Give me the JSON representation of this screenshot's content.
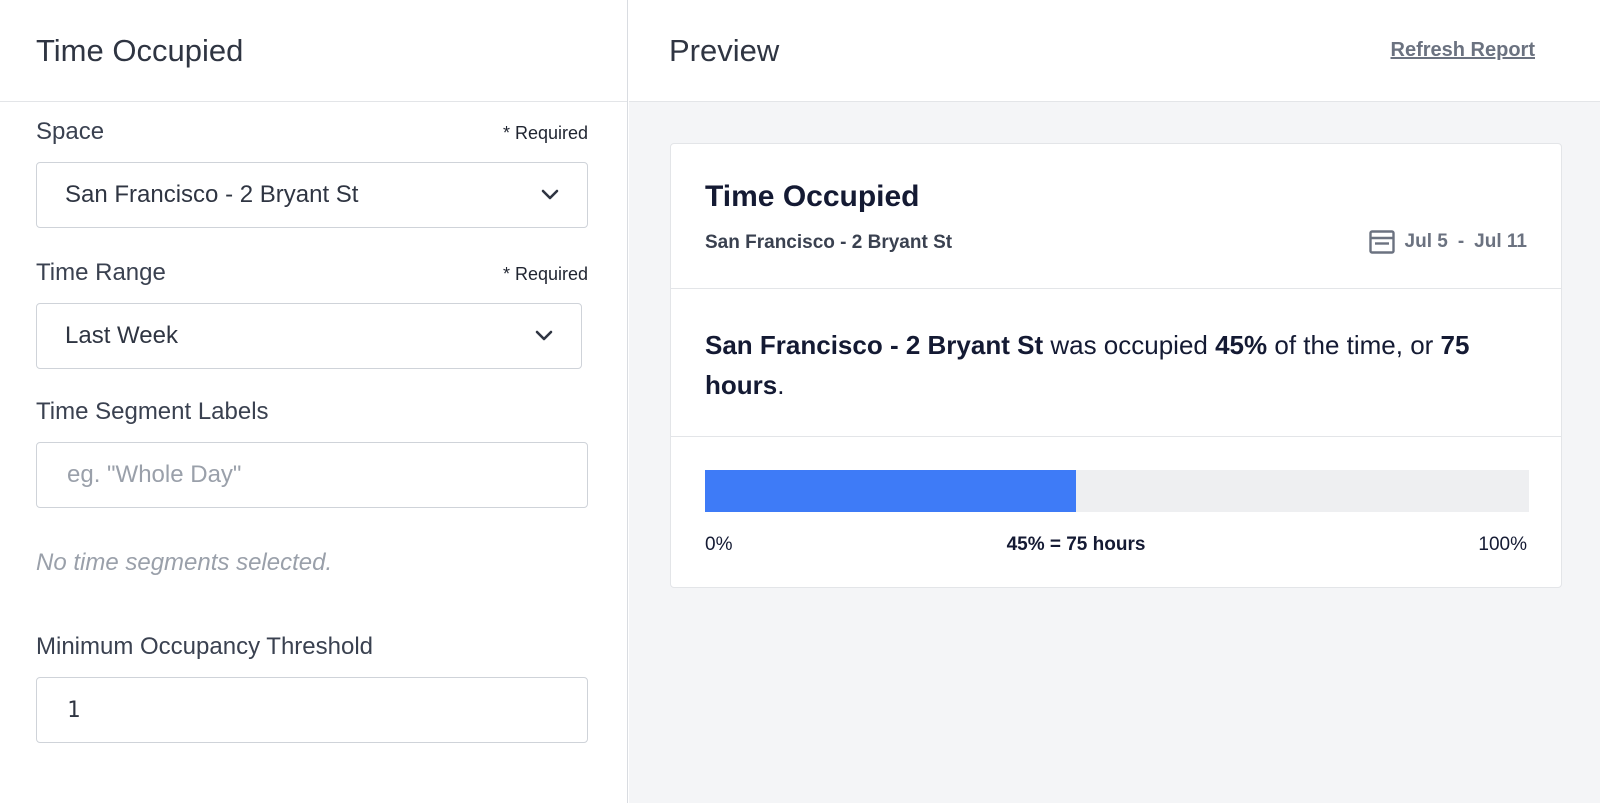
{
  "left": {
    "title": "Time Occupied",
    "space": {
      "label": "Space",
      "required": "* Required",
      "value": "San Francisco - 2 Bryant St"
    },
    "time_range": {
      "label": "Time Range",
      "required": "* Required",
      "value": "Last Week"
    },
    "segments": {
      "label": "Time Segment Labels",
      "placeholder": "eg. \"Whole Day\"",
      "empty_note": "No time segments selected."
    },
    "threshold": {
      "label": "Minimum Occupancy Threshold",
      "value": "1"
    }
  },
  "right": {
    "title": "Preview",
    "refresh_label": "Refresh Report",
    "card": {
      "title": "Time Occupied",
      "subtitle": "San Francisco - 2 Bryant St",
      "date_start": "Jul 5",
      "date_sep": "-",
      "date_end": "Jul 11",
      "summary": {
        "space": "San Francisco - 2 Bryant St",
        "text1": " was occupied ",
        "percent": "45%",
        "text2": " of the time, or ",
        "hours": "75 hours",
        "text3": "."
      },
      "bar": {
        "fill_percent": 45,
        "fill_color": "#3e7bf7",
        "min_label": "0%",
        "mid_label": "45% = 75 hours",
        "max_label": "100%"
      }
    }
  }
}
